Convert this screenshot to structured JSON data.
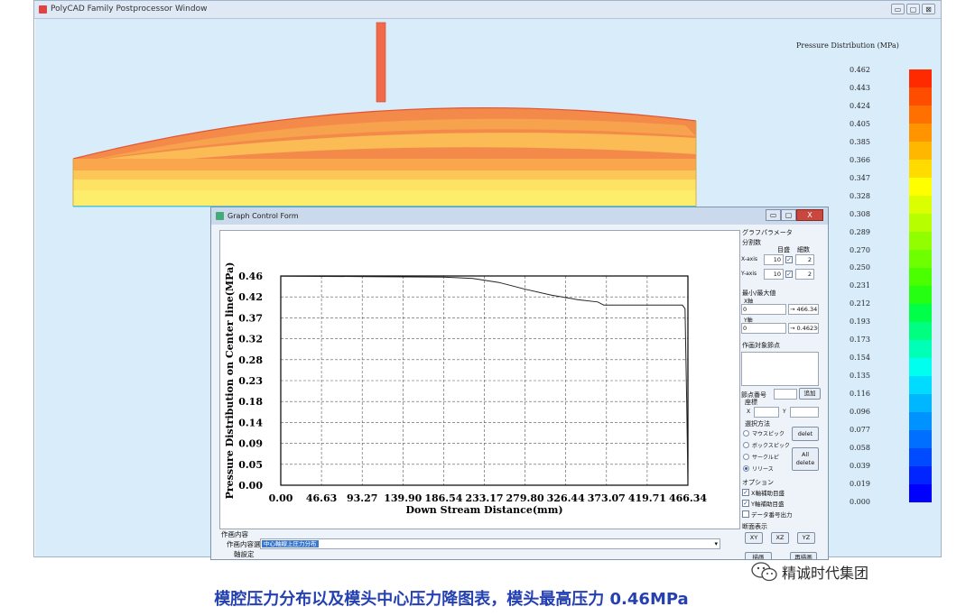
{
  "main_window": {
    "title": "PolyCAD Family Postprocessor Window",
    "controls": [
      "▭",
      "▢",
      "⊠"
    ]
  },
  "legend": {
    "title": "Pressure  Distribution (MPa)",
    "values": [
      "0.462",
      "0.443",
      "0.424",
      "0.405",
      "0.385",
      "0.366",
      "0.347",
      "0.328",
      "0.308",
      "0.289",
      "0.270",
      "0.250",
      "0.231",
      "0.212",
      "0.193",
      "0.173",
      "0.154",
      "0.135",
      "0.116",
      "0.096",
      "0.077",
      "0.058",
      "0.039",
      "0.019",
      "0.000"
    ],
    "colors": [
      "#ff2a00",
      "#ff4d00",
      "#ff7000",
      "#ff9400",
      "#ffb700",
      "#ffdb00",
      "#ffff00",
      "#dbff00",
      "#b7ff00",
      "#92ff00",
      "#6eff00",
      "#4aff00",
      "#25ff12",
      "#00ff49",
      "#00ff80",
      "#00ffb7",
      "#00ffee",
      "#00dbff",
      "#00b7ff",
      "#0092ff",
      "#006eff",
      "#004aff",
      "#0025ff",
      "#0000ff"
    ]
  },
  "graph_form": {
    "title": "Graph Control Form",
    "controls": [
      "▭",
      "▢",
      "X"
    ]
  },
  "chart_data": {
    "type": "line",
    "ylabel": "Pressure Distribution on Center line(MPa)",
    "xlabel": "Down Stream Distance(mm)",
    "x_ticks": [
      "0.00",
      "46.63",
      "93.27",
      "139.90",
      "186.54",
      "233.17",
      "279.80",
      "326.44",
      "373.07",
      "419.71",
      "466.34"
    ],
    "y_ticks": [
      "0.46",
      "0.42",
      "0.37",
      "0.32",
      "0.28",
      "0.23",
      "0.18",
      "0.14",
      "0.09",
      "0.05",
      "0.00"
    ],
    "xlim": [
      0,
      466.34
    ],
    "ylim": [
      0,
      0.4623
    ],
    "grid": true,
    "x": [
      0,
      100,
      186.5,
      220,
      250,
      280,
      310,
      340,
      363,
      370,
      460,
      463,
      465,
      466.34
    ],
    "y": [
      0.462,
      0.461,
      0.46,
      0.457,
      0.448,
      0.433,
      0.42,
      0.41,
      0.405,
      0.398,
      0.398,
      0.39,
      0.18,
      0.0
    ]
  },
  "params": {
    "graph_params": "グラフパラメータ",
    "divisions": "分割数",
    "grid_label": "目盛",
    "fine_label": "細数",
    "x_axis": "X-axis",
    "x_div": "10",
    "x_fine": "2",
    "y_axis": "Y-axis",
    "y_div": "10",
    "y_fine": "2",
    "minmax": "最小/最大値",
    "x_axis_jp": "X軸",
    "x_min": "0",
    "x_max": "→ 466.34",
    "y_axis_jp": "Y軸",
    "y_min": "0",
    "y_max": "→ 0.4623678",
    "target_nodes": "作画対象節点",
    "node_number": "節点番号",
    "add_btn": "追加",
    "coord": "座標",
    "x": "X",
    "y": "Y",
    "select_method": "選択方法",
    "mouse_pick": "マウスピック",
    "box_pick": "ボックスピック",
    "circle_pick": "サークルピ",
    "release": "リリース",
    "delete_btn": "delet",
    "all_delete_line1": "All",
    "all_delete_line2": "delete",
    "options": "オプション",
    "x_aux_grid": "X軸補助目盛",
    "y_aux_grid": "Y軸補助目盛",
    "data_output": "データ番号出力",
    "section_display": "断面表示",
    "xy_btn": "XY",
    "xz_btn": "XZ",
    "yz_btn": "YZ",
    "draw_btn": "描画",
    "redraw_btn": "再描画"
  },
  "bottom": {
    "draw_content": "作画内容",
    "content_select": "作画内容選択",
    "selected": "中心軸線上圧力分布",
    "axis_settings": "軸設定"
  },
  "caption": "模腔压力分布以及模头中心压力降图表，模头最高压力 0.46MPa",
  "watermark": "精诚时代集团"
}
